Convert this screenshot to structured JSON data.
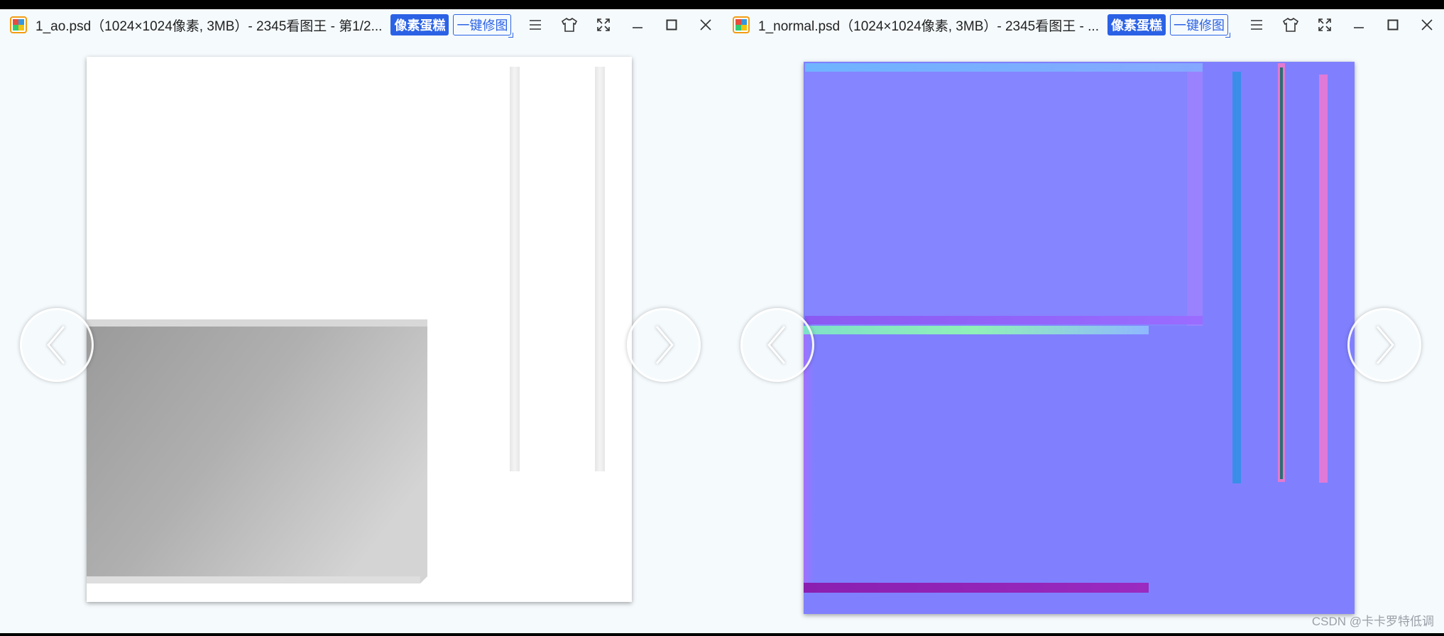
{
  "windows": [
    {
      "title": "1_ao.psd（1024×1024像素, 3MB）- 2345看图王 - 第1/2...",
      "badge_fill": "像素蛋糕",
      "badge_outline": "一键修图",
      "icons": [
        "menu-icon",
        "skin-icon",
        "fullscreen-icon",
        "minimize-icon",
        "maximize-icon",
        "close-icon"
      ]
    },
    {
      "title": "1_normal.psd（1024×1024像素, 3MB）- 2345看图王 - ...",
      "badge_fill": "像素蛋糕",
      "badge_outline": "一键修图",
      "icons": [
        "menu-icon",
        "skin-icon",
        "fullscreen-icon",
        "minimize-icon",
        "maximize-icon",
        "close-icon"
      ]
    }
  ],
  "watermark": "CSDN @卡卡罗特低调",
  "colors": {
    "window_bg": "#f5fafd",
    "brand_blue": "#2b62e5",
    "normal_map_base": "#8080ff"
  }
}
